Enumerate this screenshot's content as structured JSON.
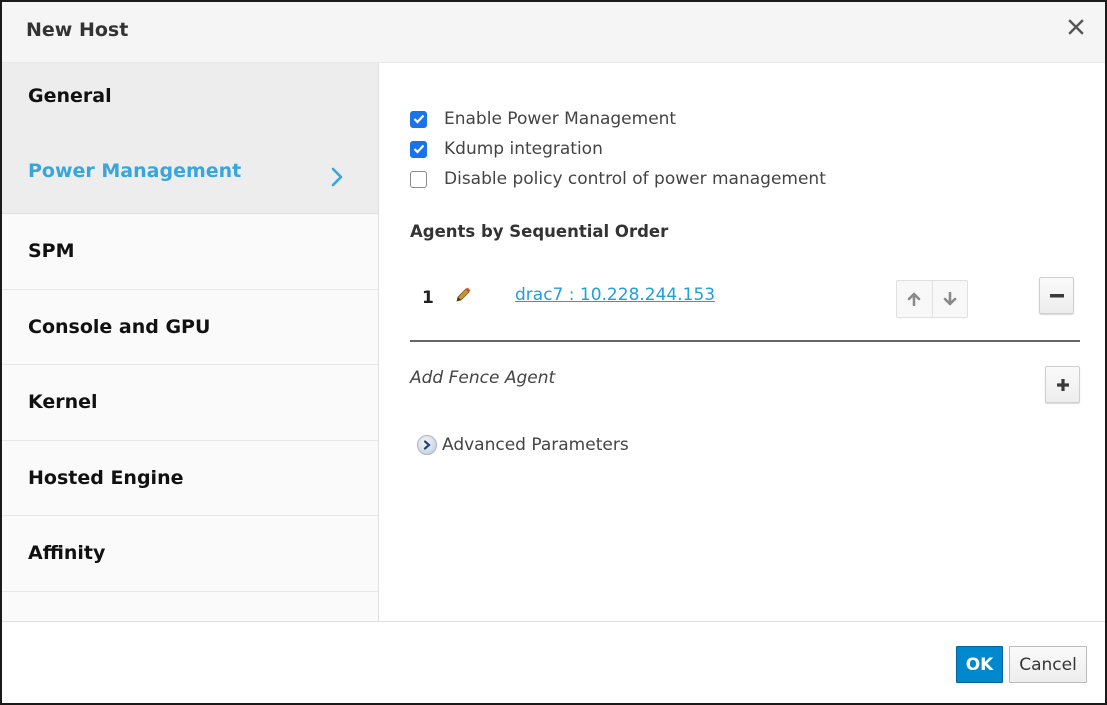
{
  "dialog": {
    "title": "New Host",
    "close_icon": "close-icon"
  },
  "sidebar": {
    "items": [
      {
        "label": "General",
        "active": false
      },
      {
        "label": "Power Management",
        "active": true
      },
      {
        "label": "SPM",
        "active": false
      },
      {
        "label": "Console and GPU",
        "active": false
      },
      {
        "label": "Kernel",
        "active": false
      },
      {
        "label": "Hosted Engine",
        "active": false
      },
      {
        "label": "Affinity",
        "active": false
      }
    ],
    "active_color": "#39a5dc"
  },
  "power_management": {
    "checkboxes": [
      {
        "label": "Enable Power Management",
        "checked": true
      },
      {
        "label": "Kdump integration",
        "checked": true
      },
      {
        "label": "Disable policy control of power management",
        "checked": false
      }
    ],
    "agents_title": "Agents by Sequential Order",
    "agents": [
      {
        "order": "1",
        "name": "drac7 : 10.228.244.153"
      }
    ],
    "add_fence_agent_label": "Add Fence Agent",
    "advanced_parameters_label": "Advanced Parameters"
  },
  "footer": {
    "ok_label": "OK",
    "cancel_label": "Cancel",
    "ok_color": "#0088ce"
  }
}
